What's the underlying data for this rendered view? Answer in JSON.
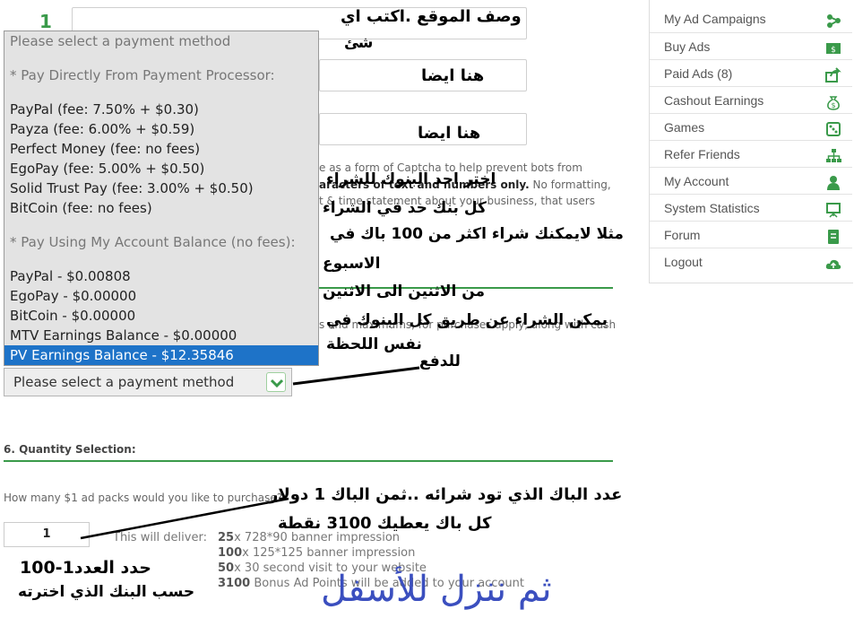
{
  "form": {
    "step_number": "1",
    "captcha_text_1": "e as a form of Captcha to help prevent bots from",
    "captcha_text_2_bold": "aracters of text and numbers only.",
    "captcha_text_2_rest": " No formatting,",
    "captcha_text_3": "t & time statement about your business, that users",
    "processor_note": "s and maximums, for purchases apply, along with cashier",
    "payment_select_value": "Please select a payment method",
    "quantity_section_title": "6. Quantity Selection:",
    "quantity_question": "How many $1 ad packs would you like to purchase?",
    "quantity_value": "1",
    "deliver_label": "This will deliver:",
    "deliver_items": [
      {
        "count": "25",
        "text": "x 728*90 banner impression"
      },
      {
        "count": "100",
        "text": "x 125*125 banner impression"
      },
      {
        "count": "50",
        "text": "x 30 second visit to your website"
      },
      {
        "count": "3100",
        "text": " Bonus Ad Points will be added to your account"
      }
    ]
  },
  "payment_dropdown": {
    "items": [
      {
        "label": "Please select a payment method",
        "type": "group"
      },
      {
        "label": "* Pay Directly From Payment Processor:",
        "type": "group"
      },
      {
        "label": "PayPal (fee: 7.50% + $0.30)",
        "type": "option"
      },
      {
        "label": "Payza (fee: 6.00% + $0.59)",
        "type": "option"
      },
      {
        "label": "Perfect Money (fee: no fees)",
        "type": "option"
      },
      {
        "label": "EgoPay (fee: 5.00% + $0.50)",
        "type": "option"
      },
      {
        "label": "Solid Trust Pay (fee: 3.00% + $0.50)",
        "type": "option"
      },
      {
        "label": "BitCoin (fee: no fees)",
        "type": "option"
      },
      {
        "label": "* Pay Using My Account Balance (no fees):",
        "type": "group"
      },
      {
        "label": "PayPal - $0.00808",
        "type": "option"
      },
      {
        "label": "EgoPay - $0.00000",
        "type": "option"
      },
      {
        "label": "BitCoin - $0.00000",
        "type": "option"
      },
      {
        "label": "MTV Earnings Balance - $0.00000",
        "type": "option"
      },
      {
        "label": "PV Earnings Balance - $12.35846",
        "type": "selected"
      }
    ]
  },
  "sidebar": {
    "items": [
      {
        "label": "My Ad Campaigns",
        "icon": "share-icon"
      },
      {
        "label": "Buy Ads",
        "icon": "money-icon"
      },
      {
        "label": "Paid Ads (8)",
        "icon": "share-arrow-icon"
      },
      {
        "label": "Cashout Earnings",
        "icon": "money-bag-icon"
      },
      {
        "label": "Games",
        "icon": "dice-icon"
      },
      {
        "label": "Refer Friends",
        "icon": "sitemap-icon"
      },
      {
        "label": "My Account",
        "icon": "user-icon"
      },
      {
        "label": "System Statistics",
        "icon": "presentation-icon"
      },
      {
        "label": "Forum",
        "icon": "book-icon"
      },
      {
        "label": "Logout",
        "icon": "cloud-upload-icon"
      }
    ],
    "accent": "#3a9a4a"
  },
  "annotations": {
    "site_desc_1": "وصف الموقع .اكتب اي",
    "site_desc_2": "شئ",
    "here_too_1": "هنا ايضا",
    "here_too_2": "هنا ايضا",
    "choose_bank": "اختر احد البنوك للشراء",
    "each_bank_limit": "كل بنك حد في الشراء",
    "example_limit": "مثلا لايمكنك شراء اكثر من 100 باك في",
    "week": "الاسبوع",
    "monday_to_monday": "من الاثنين الى الاثنين",
    "can_buy_all": "يمكن الشراء عن طريق كل البنوك في",
    "same_moment": "نفس اللحظة",
    "for_payment": "للدفع",
    "pack_count": "عدد الباك الذي تود شرائه ..ثمن الباك 1 دولار",
    "pack_points": "كل باك يعطيك 3100 نقطة",
    "set_count_1": "حدد العدد1-100",
    "set_count_2": "حسب البنك الذي اخترته",
    "scroll_down": "ثم ننزل للأسفل"
  }
}
